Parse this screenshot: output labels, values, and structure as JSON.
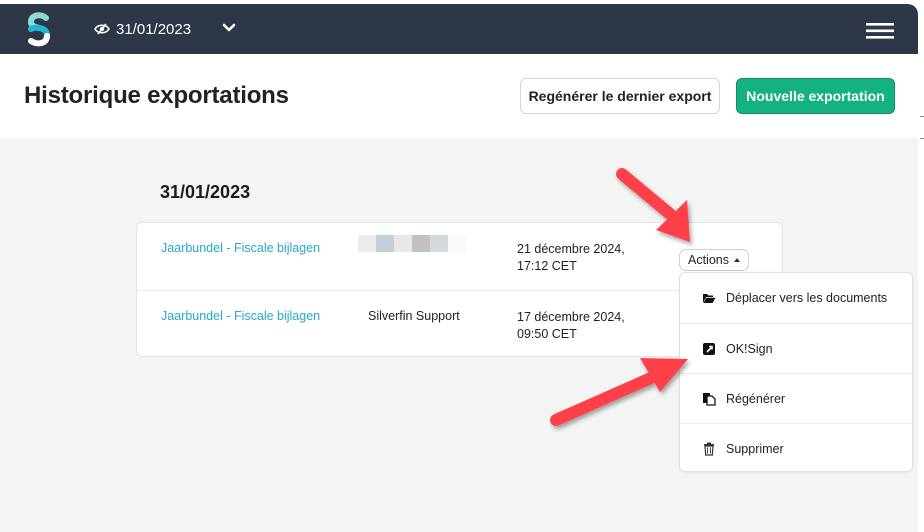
{
  "topbar": {
    "logo_name": "Silverfin",
    "visibility_icon": "eye-slash-icon",
    "period_label": "31/01/2023",
    "period_chevron": "chevron-down-icon",
    "menu_icon": "hamburger-icon"
  },
  "header": {
    "title": "Historique exportations",
    "regenerate_last_label": "Regénérer le dernier export",
    "new_export_label": "Nouvelle exportation"
  },
  "colors": {
    "topbar": "#2d3748",
    "primary": "#13b27f",
    "link": "#27a9c8",
    "annotation_arrow": "#ff414a"
  },
  "group": {
    "date": "31/01/2023",
    "rows": [
      {
        "name": "Jaarbundel - Fiscale bijlagen",
        "user": "",
        "user_redacted": true,
        "created_line1": "21 décembre 2024,",
        "created_line2": "17:12 CET",
        "actions_label": "Actions"
      },
      {
        "name": "Jaarbundel - Fiscale bijlagen",
        "user": "Silverfin Support",
        "user_redacted": false,
        "created_line1": "17 décembre 2024,",
        "created_line2": "09:50 CET",
        "actions_label": ""
      }
    ]
  },
  "actions_menu": {
    "items": [
      {
        "label": "Déplacer vers les documents",
        "icon": "folder-open-icon"
      },
      {
        "label": "OK!Sign",
        "icon": "external-link-icon"
      },
      {
        "label": "Régénérer",
        "icon": "copy-icon"
      },
      {
        "label": "Supprimer",
        "icon": "trash-icon"
      }
    ]
  }
}
